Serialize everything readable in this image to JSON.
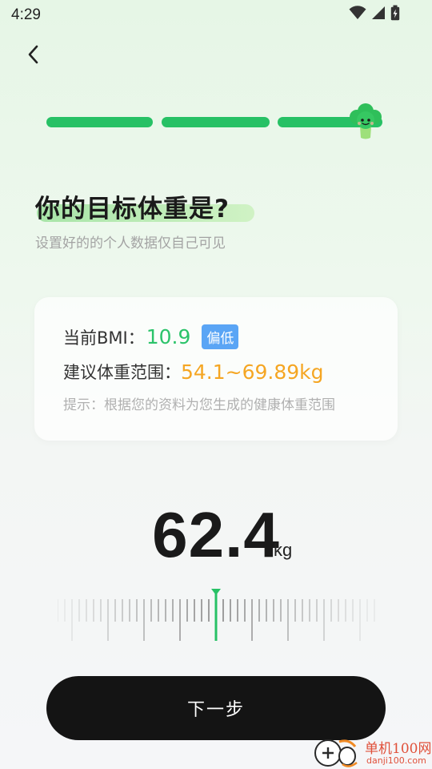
{
  "status_bar": {
    "time": "4:29"
  },
  "header": {
    "back_icon": "chevron-left-icon"
  },
  "progress": {
    "total_steps": 3,
    "completed_steps": 3,
    "color": "#27c165"
  },
  "page": {
    "title": "你的目标体重是?",
    "subtitle": "设置好的的个人数据仅自己可见"
  },
  "info_card": {
    "bmi_label": "当前BMI：",
    "bmi_value": "10.9",
    "bmi_badge": "偏低",
    "range_label": "建议体重范围：",
    "range_value": "54.1~69.89kg",
    "tip": "提示：根据您的资料为您生成的健康体重范围"
  },
  "weight": {
    "value": "62.4",
    "unit": "kg"
  },
  "actions": {
    "next_label": "下一步"
  },
  "watermark": {
    "name": "单机100网",
    "url": "danji100.com"
  },
  "colors": {
    "accent_green": "#27c165",
    "bmi_value": "#2bc36a",
    "range_value": "#f5a623",
    "badge": "#5aa5f5",
    "button": "#141414"
  }
}
